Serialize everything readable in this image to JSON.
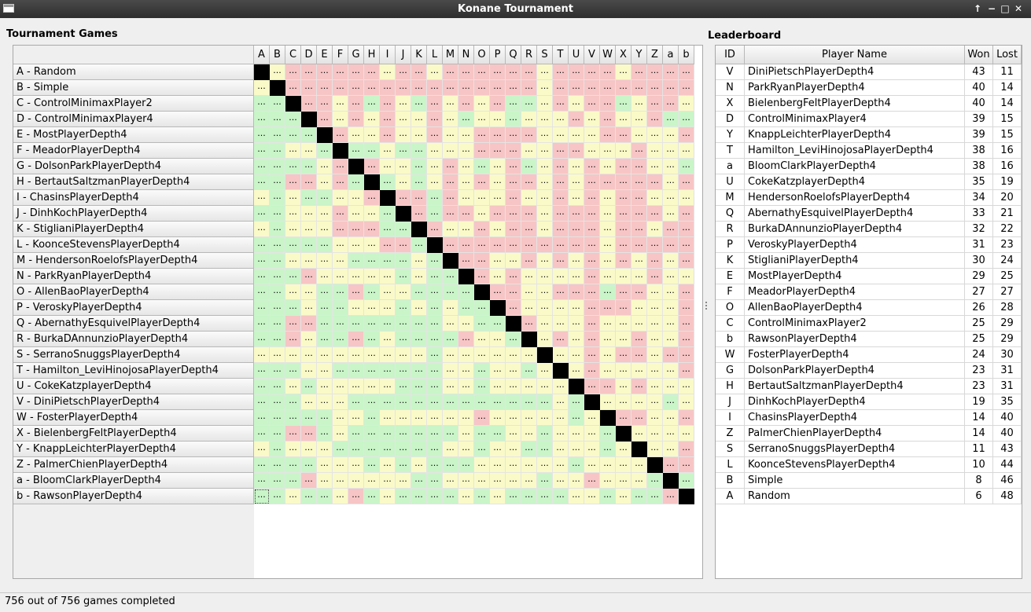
{
  "window": {
    "title": "Konane Tournament"
  },
  "sections": {
    "games_title": "Tournament Games",
    "leaderboard_title": "Leaderboard"
  },
  "status": {
    "text": "756 out of 756 games completed"
  },
  "matrix": {
    "cell_text": "...",
    "legend_colors": {
      "win": "#c9f5c9",
      "loss": "#f7c5c5",
      "tie": "#fafac8",
      "self": "#000000"
    },
    "columns": [
      "A",
      "B",
      "C",
      "D",
      "E",
      "F",
      "G",
      "H",
      "I",
      "J",
      "K",
      "L",
      "M",
      "N",
      "O",
      "P",
      "Q",
      "R",
      "S",
      "T",
      "U",
      "V",
      "W",
      "X",
      "Y",
      "Z",
      "a",
      "b"
    ],
    "rows": [
      "A - Random",
      "B - Simple",
      "C - ControlMinimaxPlayer2",
      "D - ControlMinimaxPlayer4",
      "E - MostPlayerDepth4",
      "F - MeadorPlayerDepth4",
      "G - DolsonParkPlayerDepth4",
      "H - BertautSaltzmanPlayerDepth4",
      "I - ChasinsPlayerDepth4",
      "J - DinhKochPlayerDepth4",
      "K - StiglianiPlayerDepth4",
      "L - KoonceStevensPlayerDepth4",
      "M - HendersonRoelofsPlayerDepth4",
      "N - ParkRyanPlayerDepth4",
      "O - AllenBaoPlayerDepth4",
      "P - VeroskyPlayerDepth4",
      "Q - AbernathyEsquivelPlayerDepth4",
      "R - BurkaDAnnunzioPlayerDepth4",
      "S - SerranoSnuggsPlayerDepth4",
      "T - Hamilton_LeviHinojosaPlayerDepth4",
      "U - CokeKatzplayerDepth4",
      "V - DiniPietschPlayerDepth4",
      "W - FosterPlayerDepth4",
      "X - BielenbergFeltPlayerDepth4",
      "Y - KnappLeichterPlayerDepth4",
      "Z - PalmerChienPlayerDepth4",
      "a - BloomClarkPlayerDepth4",
      "b - RawsonPlayerDepth4"
    ],
    "grid": [
      "XTLLLLLLTLLTLLLLLLTLLLLTLLLL",
      "TXLLLLLLLLLLLLLLLLTLLLLLLLLL",
      "WWXLLTLWLTWLTLTLWWTLTLLWTLLT",
      "WWWXLTLTLTTLTWTTWTTTLTLTTLWW",
      "WWWWXLTTLTTLTTLLLLTTTTLLTTTL",
      "WWTTWXWWTWWTTTLLLTTLLTTTLTTT",
      "WWWWTLXLTTWTLTWTLWTLTLTLLTTW",
      "WWLLTLWXWTWTLTLTLLTLTLLLLLTL",
      "TWTWWTTLXLLWLTTTLTTLTLTLLTTT",
      "WWTTTLTTWXLWLLTLLLTLLLTLLLTL",
      "TWTTTLLLWWXLTTLTLLTLLLTLLTLL",
      "WWWWWTTTLLWXLLLLLLLLLLTLLLLL",
      "WWTTTTWWWWTWXLLTTLTLTLTLTLTL",
      "WWWLTTTTTWTWWXLTLTTTTLTTTLTT",
      "WWTTWWLWTTWWWWXLLTTLLLWLLTTL",
      "WWWTWWTTTWTWTWWXLTTTTLLLTTTL",
      "WWLLWWWWWWWWTTWWXLTTTLTTTTTL",
      "WWLTWWLWTWWWWLTTWXTLTLTTLTTL",
      "TTTTTTTTTTTWTTTTTTXTTLTLLTLL",
      "WWWTTWWWWWWWTTWTTWTXTLTTTTTL",
      "WWTWTTTTTWWWTTWTTTTTXLLTLTTT",
      "WWWTTTWWWWWWWWWWWWWTWXTTTTWT",
      "WWWWWTTWTTTTTTLTTTTTWTXLLTTL",
      "WWLLWTWWWWWWWTWWTTWTTTWXTTTT",
      "TWTTTWWWWWWWTTWTTWWTTTWTXTTL",
      "WWWWTTTWTWTWWWTTTTTTWTTTTXLL",
      "WWWLTTTTTTWWTTTTTTWTTLTTTWXW",
      "WWTWWTLWTWWWWTWTWWWWTTWTWWLX"
    ]
  },
  "leaderboard": {
    "headers": {
      "id": "ID",
      "name": "Player Name",
      "won": "Won",
      "lost": "Lost"
    },
    "rows": [
      {
        "id": "V",
        "name": "DiniPietschPlayerDepth4",
        "won": "43",
        "lost": "11"
      },
      {
        "id": "N",
        "name": "ParkRyanPlayerDepth4",
        "won": "40",
        "lost": "14"
      },
      {
        "id": "X",
        "name": "BielenbergFeltPlayerDepth4",
        "won": "40",
        "lost": "14"
      },
      {
        "id": "D",
        "name": "ControlMinimaxPlayer4",
        "won": "39",
        "lost": "15"
      },
      {
        "id": "Y",
        "name": "KnappLeichterPlayerDepth4",
        "won": "39",
        "lost": "15"
      },
      {
        "id": "T",
        "name": "Hamilton_LeviHinojosaPlayerDepth4",
        "won": "38",
        "lost": "16"
      },
      {
        "id": "a",
        "name": "BloomClarkPlayerDepth4",
        "won": "38",
        "lost": "16"
      },
      {
        "id": "U",
        "name": "CokeKatzplayerDepth4",
        "won": "35",
        "lost": "19"
      },
      {
        "id": "M",
        "name": "HendersonRoelofsPlayerDepth4",
        "won": "34",
        "lost": "20"
      },
      {
        "id": "Q",
        "name": "AbernathyEsquivelPlayerDepth4",
        "won": "33",
        "lost": "21"
      },
      {
        "id": "R",
        "name": "BurkaDAnnunzioPlayerDepth4",
        "won": "32",
        "lost": "22"
      },
      {
        "id": "P",
        "name": "VeroskyPlayerDepth4",
        "won": "31",
        "lost": "23"
      },
      {
        "id": "K",
        "name": "StiglianiPlayerDepth4",
        "won": "30",
        "lost": "24"
      },
      {
        "id": "E",
        "name": "MostPlayerDepth4",
        "won": "29",
        "lost": "25"
      },
      {
        "id": "F",
        "name": "MeadorPlayerDepth4",
        "won": "27",
        "lost": "27"
      },
      {
        "id": "O",
        "name": "AllenBaoPlayerDepth4",
        "won": "26",
        "lost": "28"
      },
      {
        "id": "C",
        "name": "ControlMinimaxPlayer2",
        "won": "25",
        "lost": "29"
      },
      {
        "id": "b",
        "name": "RawsonPlayerDepth4",
        "won": "25",
        "lost": "29"
      },
      {
        "id": "W",
        "name": "FosterPlayerDepth4",
        "won": "24",
        "lost": "30"
      },
      {
        "id": "G",
        "name": "DolsonParkPlayerDepth4",
        "won": "23",
        "lost": "31"
      },
      {
        "id": "H",
        "name": "BertautSaltzmanPlayerDepth4",
        "won": "23",
        "lost": "31"
      },
      {
        "id": "J",
        "name": "DinhKochPlayerDepth4",
        "won": "19",
        "lost": "35"
      },
      {
        "id": "I",
        "name": "ChasinsPlayerDepth4",
        "won": "14",
        "lost": "40"
      },
      {
        "id": "Z",
        "name": "PalmerChienPlayerDepth4",
        "won": "14",
        "lost": "40"
      },
      {
        "id": "S",
        "name": "SerranoSnuggsPlayerDepth4",
        "won": "11",
        "lost": "43"
      },
      {
        "id": "L",
        "name": "KoonceStevensPlayerDepth4",
        "won": "10",
        "lost": "44"
      },
      {
        "id": "B",
        "name": "Simple",
        "won": "8",
        "lost": "46"
      },
      {
        "id": "A",
        "name": "Random",
        "won": "6",
        "lost": "48"
      }
    ]
  }
}
